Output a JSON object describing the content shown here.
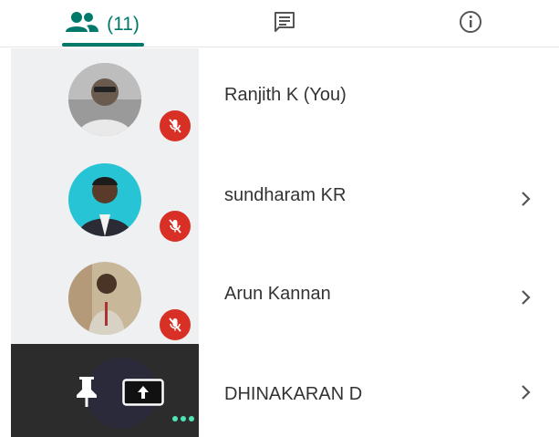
{
  "tabs": {
    "people_count": "(11)",
    "people_icon": "people-icon",
    "chat_icon": "chat-icon",
    "info_icon": "info-icon"
  },
  "participants": [
    {
      "name": "Ranjith K (You)",
      "mic": "muted"
    },
    {
      "name": "sundharam KR",
      "mic": "muted"
    },
    {
      "name": "Arun Kannan",
      "mic": "muted"
    },
    {
      "name": "DHINAKARAN D",
      "pinned": true,
      "presenting": true
    }
  ],
  "colors": {
    "accent": "#00796b",
    "muted_badge": "#d93025",
    "strip_bg": "#eef0f2",
    "dark_tile": "#2c2c2c",
    "speaking_dots": "#4fe3b5"
  }
}
